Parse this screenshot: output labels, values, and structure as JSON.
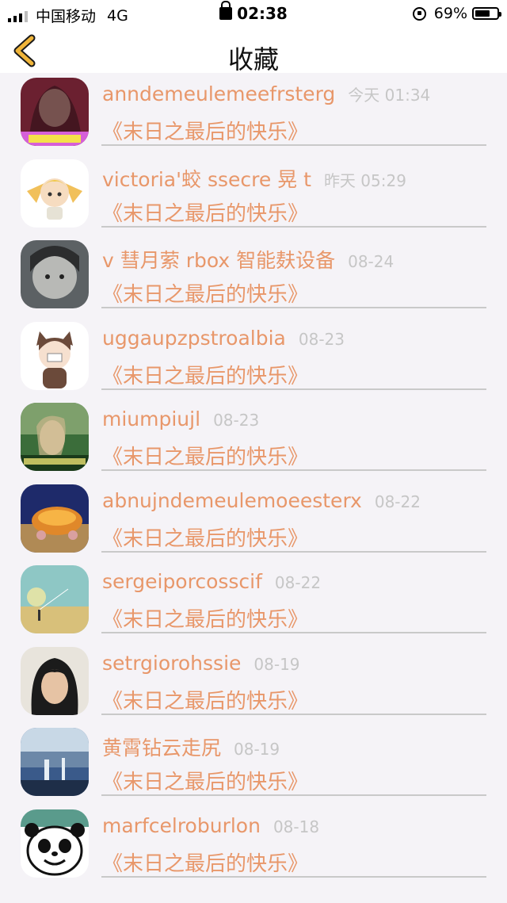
{
  "status_bar": {
    "carrier": "中国移动",
    "network": "4G",
    "time": "02:38",
    "battery": "69%",
    "battery_level": 0.69
  },
  "nav": {
    "title": "收藏",
    "back_icon": "chevron-left-icon"
  },
  "colors": {
    "accent": "#e8976a",
    "back_arrow": "#f0b53a",
    "timestamp": "#c6c6c6"
  },
  "favorites": [
    {
      "name": "anndemeulemeefrsterg",
      "time": "今天 01:34",
      "title": "《末日之最后的快乐》"
    },
    {
      "name": "victoria'蛟 ssecre 晃 t",
      "time": "昨天 05:29",
      "title": "《末日之最后的快乐》"
    },
    {
      "name": "v 彗月萦 rbox 智能麸设备",
      "time": "08-24",
      "title": "《末日之最后的快乐》"
    },
    {
      "name": "uggaupzpstroalbia",
      "time": "08-23",
      "title": "《末日之最后的快乐》"
    },
    {
      "name": "miumpiujl",
      "time": "08-23",
      "title": "《末日之最后的快乐》"
    },
    {
      "name": "abnujndemeulemoeesterx",
      "time": "08-22",
      "title": "《末日之最后的快乐》"
    },
    {
      "name": "sergeiporcosscif",
      "time": "08-22",
      "title": "《末日之最后的快乐》"
    },
    {
      "name": "setrgiorohssie",
      "time": "08-19",
      "title": "《末日之最后的快乐》"
    },
    {
      "name": "黄霄钻云走尻",
      "time": "08-19",
      "title": "《末日之最后的快乐》"
    },
    {
      "name": "marfcelroburlon",
      "time": "08-18",
      "title": "《末日之最后的快乐》"
    }
  ]
}
